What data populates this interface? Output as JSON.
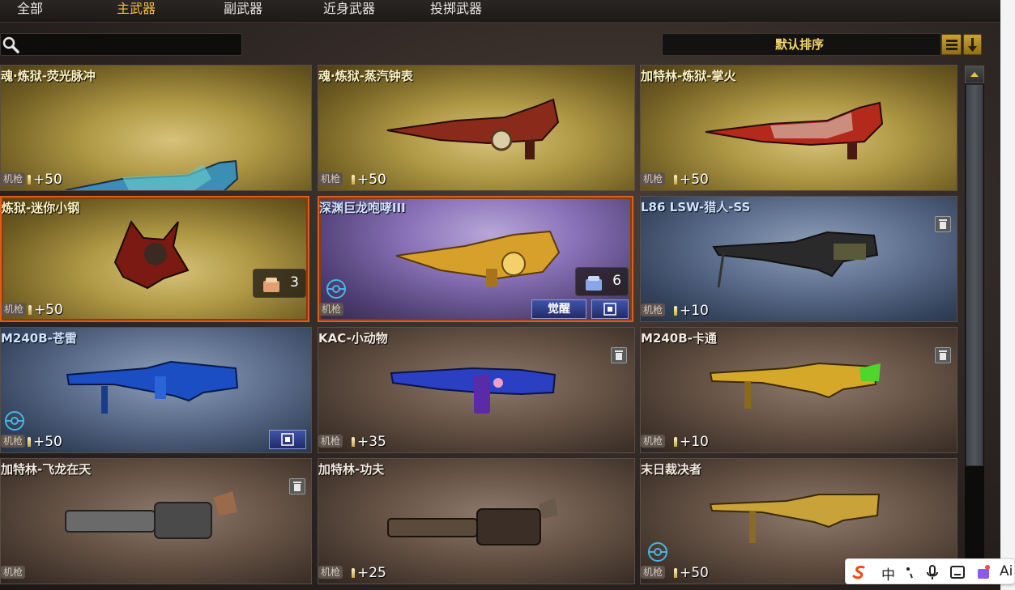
{
  "tabs": [
    "全部",
    "主武器",
    "副武器",
    "近身武器",
    "投掷武器"
  ],
  "active_tab": "主武器",
  "search": {
    "placeholder": "",
    "value": ""
  },
  "sort": {
    "label": "默认排序"
  },
  "weapon_type": "机枪",
  "cards": [
    {
      "name": "魂·炼狱-荧光脉冲",
      "type": "机枪",
      "level": "+50"
    },
    {
      "name": "魂·炼狱-蒸汽钟表",
      "type": "机枪",
      "level": "+50"
    },
    {
      "name": "加特林-炼狱-掌火",
      "type": "机枪",
      "level": "+50"
    },
    {
      "name": "炼狱-迷你小钢",
      "type": "机枪",
      "level": "+50",
      "count": "3"
    },
    {
      "name": "深渊巨龙咆哮III",
      "type": "机枪",
      "level": "",
      "count": "6",
      "wake_label": "觉醒"
    },
    {
      "name": "L86 LSW-猎人-SS",
      "type": "机枪",
      "level": "+10"
    },
    {
      "name": "M240B-苍雷",
      "type": "机枪",
      "level": "+50"
    },
    {
      "name": "KAC-小动物",
      "type": "机枪",
      "level": "+35"
    },
    {
      "name": "M240B-卡通",
      "type": "机枪",
      "level": "+10"
    },
    {
      "name": "加特林-飞龙在天",
      "type": "机枪",
      "level": ""
    },
    {
      "name": "加特林-功夫",
      "type": "机枪",
      "level": "+25"
    },
    {
      "name": "末日裁决者",
      "type": "机枪",
      "level": "+50"
    }
  ],
  "ime": {
    "cn": "中",
    "ai": "Ai"
  },
  "colors": {
    "accent": "#f1c040",
    "gold_card": "#b09a46",
    "blue_card": "#5f7190",
    "brown_card": "#6a5749",
    "purple_card": "#8a72b8",
    "selected_border": "#d9601a"
  }
}
